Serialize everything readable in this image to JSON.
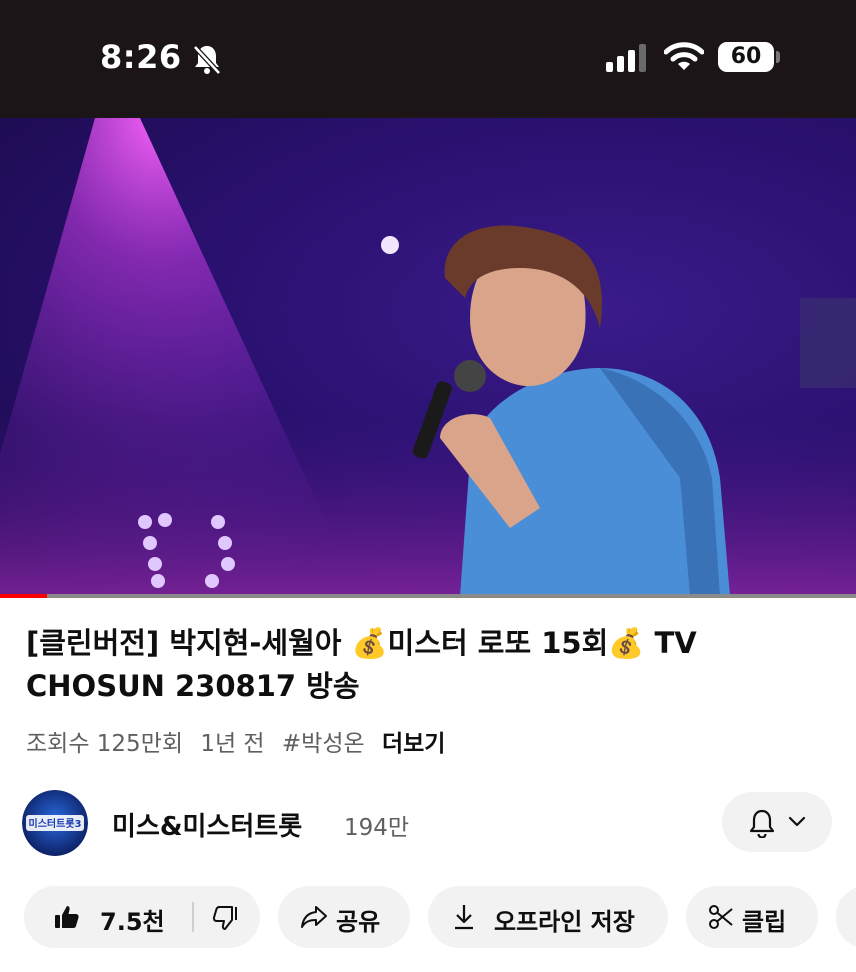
{
  "status_bar": {
    "time": "8:26",
    "battery": "60",
    "icons": [
      "bell-off-icon",
      "cellular-signal-icon",
      "wifi-icon",
      "battery-icon"
    ]
  },
  "video": {
    "progress": 0.055,
    "progress_color": "#ff0000"
  },
  "title": "[클린버전] 박지현-세월아 💰미스터 로또 15회💰 TV CHOSUN 230817 방송",
  "meta": {
    "views": "조회수 125만회",
    "age": "1년 전",
    "hashtag": "#박성온",
    "more": "더보기"
  },
  "channel": {
    "avatar_text": "미스터트롯3",
    "name": "미스&미스터트롯",
    "subscribers": "194만"
  },
  "actions": {
    "like_count": "7.5천",
    "share": "공유",
    "download": "오프라인 저장",
    "clip": "클립"
  },
  "colors": {
    "accent": "#ff0000",
    "pill_bg": "#f2f2f2",
    "text": "#0f0f0f",
    "secondary_text": "#606060"
  }
}
